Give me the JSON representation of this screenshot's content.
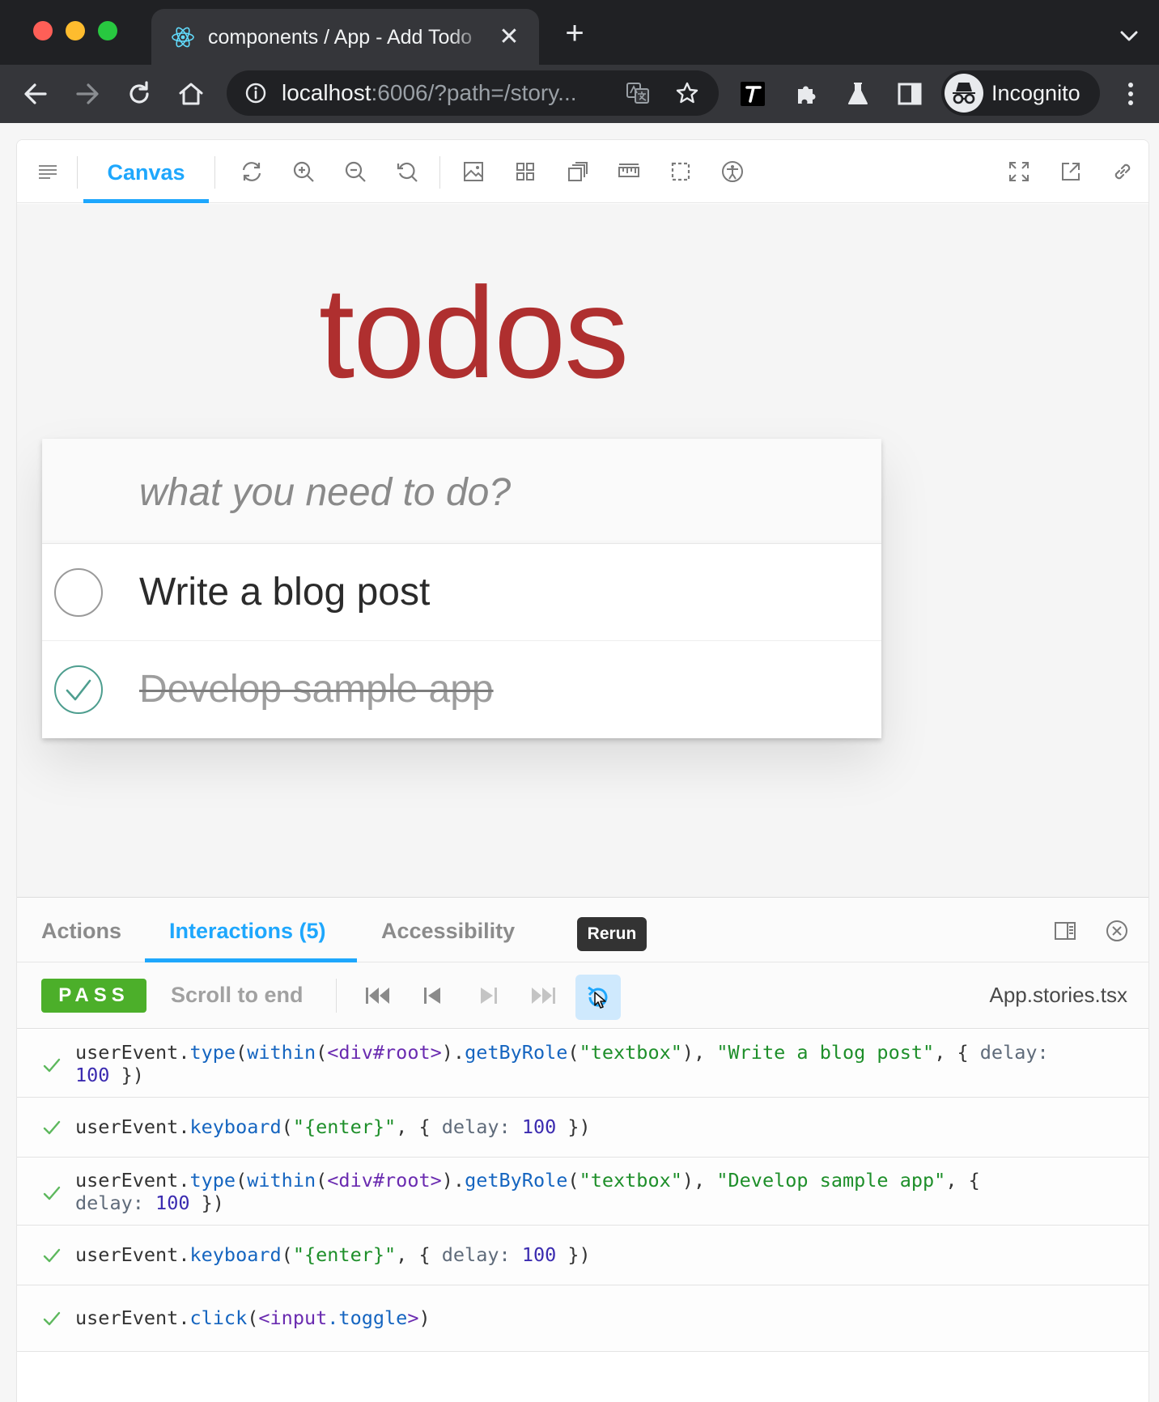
{
  "browser": {
    "tab_title": "components / App - Add Todo",
    "tab_close": "✕",
    "new_tab": "+",
    "url_host": "localhost",
    "url_rest": ":6006/?path=/story...",
    "incognito_label": "Incognito",
    "icons": [
      "react-icon",
      "back-icon",
      "forward-icon",
      "reload-icon",
      "home-icon",
      "info-icon",
      "translate-icon",
      "star-icon",
      "t-extension-icon",
      "puzzle-icon",
      "flask-icon",
      "sidepanel-icon",
      "incognito-icon",
      "kebab-menu-icon",
      "tab-search-icon"
    ]
  },
  "storybook": {
    "toolbar": {
      "canvas_tab": "Canvas",
      "icons": [
        "sidebar-icon",
        "remount-icon",
        "zoom-in-icon",
        "zoom-out-icon",
        "zoom-reset-icon",
        "background-icon",
        "grid-icon",
        "viewport-icon",
        "measure-icon",
        "outline-icon",
        "accessibility-icon",
        "fullscreen-icon",
        "new-tab-icon",
        "copy-link-icon"
      ]
    },
    "app": {
      "title": "todos",
      "new_todo_placeholder": "what you need to do?",
      "todos": [
        {
          "text": "Write a blog post",
          "completed": false
        },
        {
          "text": "Develop sample app",
          "completed": true
        }
      ]
    },
    "addon": {
      "tabs": [
        {
          "label": "Actions",
          "active": false
        },
        {
          "label": "Interactions (5)",
          "active": true
        },
        {
          "label": "Accessibility",
          "active": false
        }
      ],
      "tooltip": "Rerun",
      "status": "PASS",
      "scroll_to_end": "Scroll to end",
      "file_name": "App.stories.tsx",
      "log": [
        {
          "status": "passed",
          "line1": "userEvent.type(within(<div#root>).getByRole(\"textbox\"), \"Write a blog post\", { delay:",
          "line2": "100 })"
        },
        {
          "status": "passed",
          "line1": "userEvent.keyboard(\"{enter}\", { delay: 100 })",
          "line2": ""
        },
        {
          "status": "passed",
          "line1": "userEvent.type(within(<div#root>).getByRole(\"textbox\"), \"Develop sample app\", {",
          "line2": "delay: 100 })"
        },
        {
          "status": "passed",
          "line1": "userEvent.keyboard(\"{enter}\", { delay: 100 })",
          "line2": ""
        },
        {
          "status": "passed",
          "line1": "userEvent.click(<input.toggle>)",
          "line2": ""
        }
      ]
    }
  },
  "colors": {
    "accent": "#1ea7fd",
    "todos_title": "#af2f2f",
    "pass": "#4caf2a",
    "checkmark": "#5db85d"
  }
}
